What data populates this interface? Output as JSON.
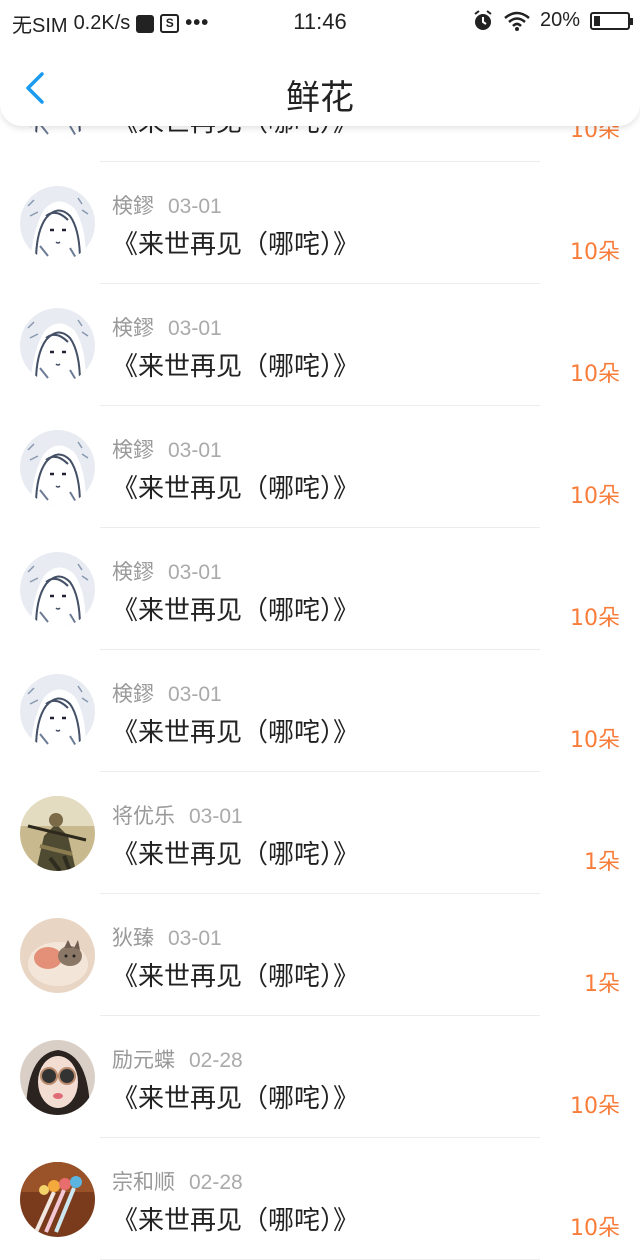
{
  "status_bar": {
    "carrier": "无SIM",
    "speed": "0.2K/s",
    "dots": "•••",
    "time": "11:46",
    "battery": "20%",
    "battery_level": 0.2
  },
  "header": {
    "title": "鲜花"
  },
  "items": [
    {
      "name": "検鏐",
      "date": "03-01",
      "title": "《来世再见（哪咤）》",
      "count": "10朵",
      "avatar": "sketch-girl"
    },
    {
      "name": "検鏐",
      "date": "03-01",
      "title": "《来世再见（哪咤）》",
      "count": "10朵",
      "avatar": "sketch-girl"
    },
    {
      "name": "検鏐",
      "date": "03-01",
      "title": "《来世再见（哪咤）》",
      "count": "10朵",
      "avatar": "sketch-girl"
    },
    {
      "name": "検鏐",
      "date": "03-01",
      "title": "《来世再见（哪咤）》",
      "count": "10朵",
      "avatar": "sketch-girl"
    },
    {
      "name": "検鏐",
      "date": "03-01",
      "title": "《来世再见（哪咤）》",
      "count": "10朵",
      "avatar": "sketch-girl"
    },
    {
      "name": "将优乐",
      "date": "03-01",
      "title": "《来世再见（哪咤）》",
      "count": "1朵",
      "avatar": "warrior"
    },
    {
      "name": "狄臻",
      "date": "03-01",
      "title": "《来世再见（哪咤）》",
      "count": "1朵",
      "avatar": "cat"
    },
    {
      "name": "励元蝶",
      "date": "02-28",
      "title": "《来世再见（哪咤）》",
      "count": "10朵",
      "avatar": "woman-glasses"
    },
    {
      "name": "宗和顺",
      "date": "02-28",
      "title": "《来世再见（哪咤）》",
      "count": "10朵",
      "avatar": "pens"
    }
  ],
  "colors": {
    "accent": "#1a9af0",
    "count": "#f97d3a",
    "name": "#999999",
    "title": "#222222"
  }
}
